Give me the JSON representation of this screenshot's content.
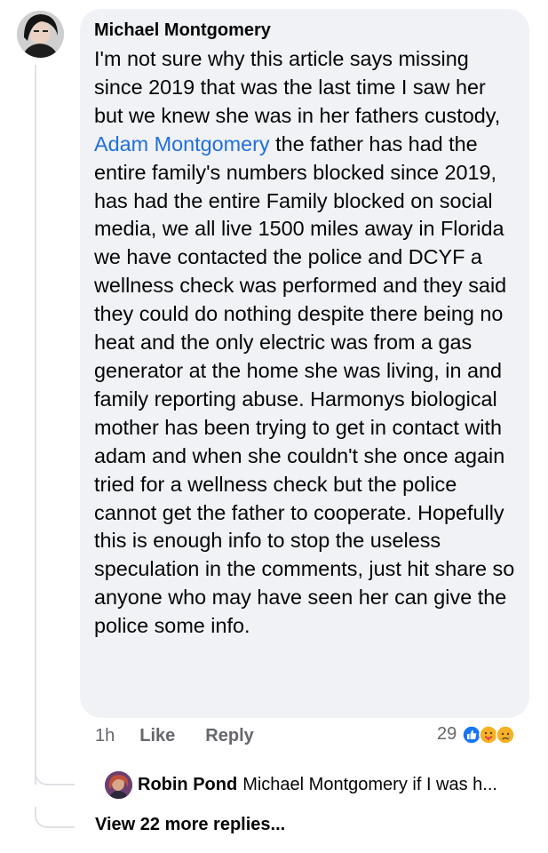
{
  "comment": {
    "author": "Michael Montgomery",
    "text_before_mention": "I'm not sure why this article says missing since 2019 that was the last time I saw her but we knew she was in her fathers custody, ",
    "mention": "Adam Montgomery",
    "text_after_mention": " the father has had the entire family's numbers blocked since 2019, has had the entire Family blocked on social media, we all live 1500 miles away in Florida we have contacted the police and DCYF a wellness check was performed and they said they could do nothing despite there being no heat and the only electric was from a gas generator at the home she was living, in and family reporting abuse. Harmonys biological mother has been trying to get in contact with adam and when she couldn't she once again tried for a wellness check but the police cannot get the father to cooperate. Hopefully this is enough info to stop the useless speculation in the comments, just hit share so anyone who may have seen her can give the police some info.",
    "timestamp": "1h",
    "like_label": "Like",
    "reply_label": "Reply",
    "reaction_count": "29",
    "reaction_icons": [
      "like-icon",
      "care-icon",
      "sad-icon"
    ]
  },
  "reply_preview": {
    "author": "Robin Pond",
    "text": "Michael Montgomery if I was h..."
  },
  "view_more_label": "View 22 more replies...",
  "colors": {
    "bubble": "#f0f2f5",
    "mention": "#216fdb",
    "muted": "#65676b",
    "like_blue": "#1877f2",
    "reaction_yellow": "#f7b125"
  }
}
